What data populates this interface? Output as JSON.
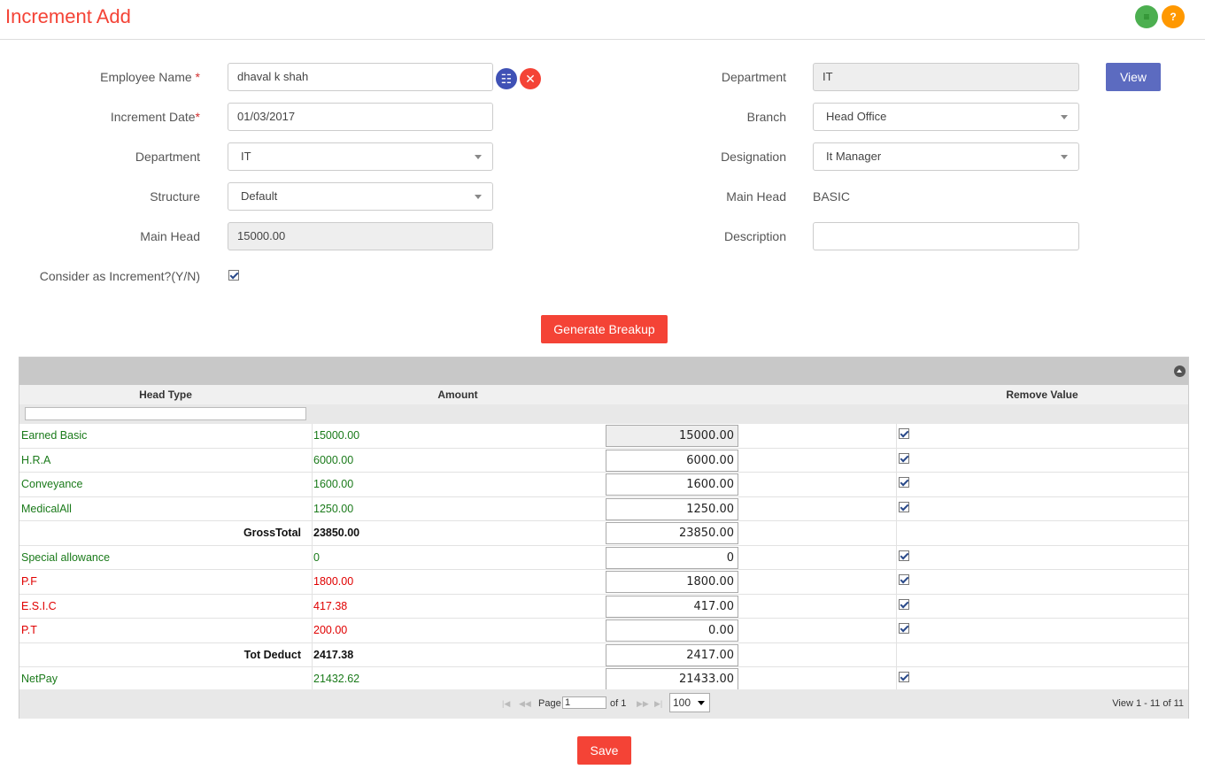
{
  "page": {
    "title": "Increment Add",
    "menu_icon": "≡",
    "help_icon": "?"
  },
  "form": {
    "employee_name_label": "Employee Name",
    "employee_name_value": "dhaval k  shah",
    "increment_date_label": "Increment Date",
    "increment_date_value": "01/03/2017",
    "department_label": "Department",
    "department_value": "IT",
    "structure_label": "Structure",
    "structure_value": "Default",
    "main_head_label": "Main Head",
    "main_head_value": "15000.00",
    "consider_label": "Consider as Increment?(Y/N)",
    "right_department_label": "Department",
    "right_department_value": "IT",
    "view_button": "View",
    "branch_label": "Branch",
    "branch_value": "Head Office",
    "designation_label": "Designation",
    "designation_value": "It Manager",
    "right_main_head_label": "Main Head",
    "right_main_head_value": "BASIC",
    "description_label": "Description",
    "description_value": "",
    "required_mark": "*",
    "grid_icon": "☷",
    "clear_icon": "✕"
  },
  "generate_button": "Generate Breakup",
  "grid": {
    "columns": {
      "head_type": "Head Type",
      "amount": "Amount",
      "remove_value": "Remove Value"
    },
    "rows": [
      {
        "head": "Earned Basic",
        "amount": "15000.00",
        "input": "15000.00",
        "checked": true,
        "kind": "earning"
      },
      {
        "head": "H.R.A",
        "amount": "6000.00",
        "input": "6000.00",
        "checked": true,
        "kind": "earning"
      },
      {
        "head": "Conveyance",
        "amount": "1600.00",
        "input": "1600.00",
        "checked": true,
        "kind": "earning"
      },
      {
        "head": "MedicalAll",
        "amount": "1250.00",
        "input": "1250.00",
        "checked": true,
        "kind": "earning"
      },
      {
        "head": "GrossTotal",
        "amount": "23850.00",
        "input": "23850.00",
        "checked": false,
        "kind": "total"
      },
      {
        "head": "Special allowance",
        "amount": "0",
        "input": "0",
        "checked": true,
        "kind": "earning"
      },
      {
        "head": "P.F",
        "amount": "1800.00",
        "input": "1800.00",
        "checked": true,
        "kind": "deduction"
      },
      {
        "head": "E.S.I.C",
        "amount": "417.38",
        "input": "417.00",
        "checked": true,
        "kind": "deduction"
      },
      {
        "head": "P.T",
        "amount": "200.00",
        "input": "0.00",
        "checked": true,
        "kind": "deduction"
      },
      {
        "head": "Tot Deduct",
        "amount": "2417.38",
        "input": "2417.00",
        "checked": false,
        "kind": "total"
      },
      {
        "head": "NetPay",
        "amount": "21432.62",
        "input": "21433.00",
        "checked": true,
        "kind": "earning"
      }
    ],
    "pager": {
      "page_label": "Page",
      "page_value": "1",
      "of_label": "of 1",
      "page_size": "100",
      "view_info": "View 1 - 11 of 11"
    }
  },
  "save_button": "Save"
}
